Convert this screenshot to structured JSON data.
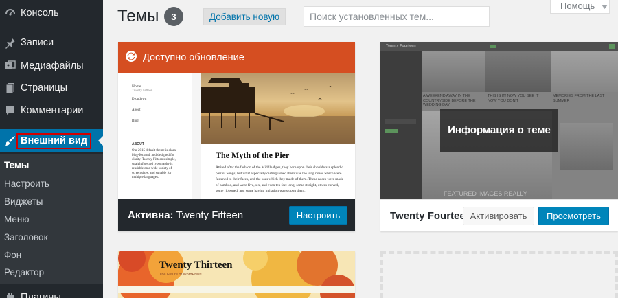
{
  "sidebar": {
    "items": [
      {
        "label": "Консоль",
        "icon": "dashboard-icon"
      },
      {
        "label": "Записи",
        "icon": "pin-icon"
      },
      {
        "label": "Медиафайлы",
        "icon": "media-icon"
      },
      {
        "label": "Страницы",
        "icon": "pages-icon"
      },
      {
        "label": "Комментарии",
        "icon": "comments-icon"
      },
      {
        "label": "Внешний вид",
        "icon": "appearance-brush-icon"
      },
      {
        "label": "Плагины",
        "icon": "plugins-icon"
      }
    ],
    "submenu": [
      "Темы",
      "Настроить",
      "Виджеты",
      "Меню",
      "Заголовок",
      "Фон",
      "Редактор"
    ],
    "current_submenu": "Темы"
  },
  "header": {
    "title": "Темы",
    "count": "3",
    "add_new": "Добавить новую",
    "search_placeholder": "Поиск установленных тем...",
    "help": "Помощь"
  },
  "themes": {
    "fifteen": {
      "update_notice": "Доступно обновление",
      "active_prefix": "Активна:",
      "name": "Twenty Fifteen",
      "customize": "Настроить",
      "screenshot": {
        "post_title": "The Myth of the Pier",
        "excerpt": "Attired after the fashion of the Middle Ages, they bore upon their shoulders a splendid pair of wings; but what especially distinguished them was the long noses which were fastened to their faces, and the uses which they made of them. These noses were made of bamboo, and were five, six, and even ten feet long, some straight, others curved, some ribboned, and some having imitation warts upon them.",
        "sidebar_title": "Twenty Fifteen",
        "sidebar_links": [
          "Home",
          "Dropdown",
          "About",
          "Blog"
        ],
        "about_heading": "ABOUT",
        "about_text": "Our 2015 default theme is clean, blog-focused, and designed for clarity. Twenty Fifteen's simple, straightforward typography is readable on a wide variety of screen sizes, and suitable for multiple languages."
      }
    },
    "fourteen": {
      "name": "Twenty Fourteen",
      "overlay": "Информация о теме",
      "activate": "Активировать",
      "preview": "Просмотреть",
      "screenshot": {
        "site_title": "Twenty Fourteen",
        "captions": [
          "A WEEKEND AWAY IN THE COUNTRYSIDE BEFORE THE WEDDING DAY",
          "THIS IS IT! NOW YOU SEE IT NOW YOU DON'T",
          "MEMORIES FROM THE LAST SUMMER"
        ],
        "featured": "FEATURED IMAGES REALLY"
      }
    },
    "thirteen": {
      "screenshot": {
        "title": "Twenty Thirteen",
        "subtitle": "The Future of WordPress"
      }
    }
  },
  "colors": {
    "sidebar_bg": "#23282d",
    "submenu_bg": "#32373c",
    "accent": "#0073aa",
    "update_banner": "#d54e21",
    "highlight_border": "#d00000"
  }
}
